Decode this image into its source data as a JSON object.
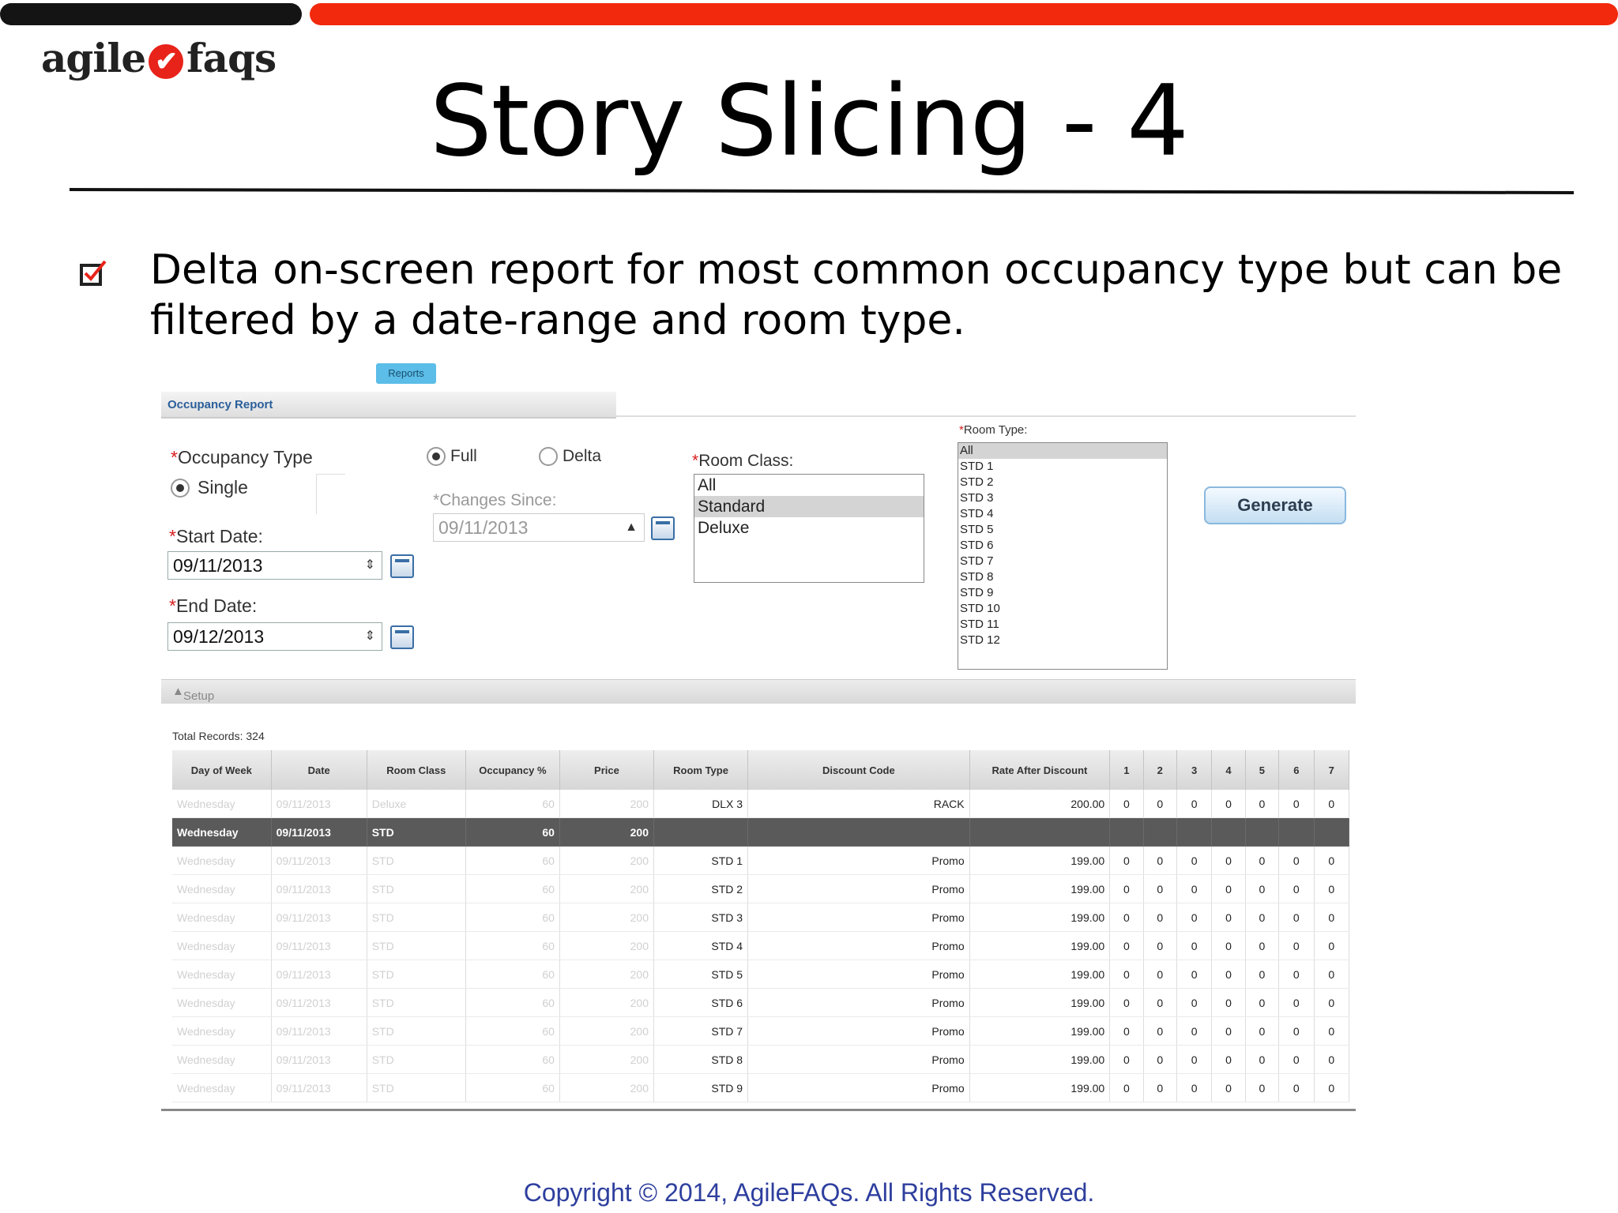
{
  "slide": {
    "logo_left": "agile",
    "logo_right": "faqs",
    "title": "Story Slicing - 4",
    "bullet": "Delta on-screen report for most common occupancy type but can be filtered by a date-range and room type.",
    "copyright": "Copyright © 2014, AgileFAQs. All Rights Reserved.",
    "accent_color": "#f2290c"
  },
  "app": {
    "reports_tab": "Reports",
    "header": "Occupancy Report",
    "occupancy_type_label": "Occupancy Type",
    "single_label": "Single",
    "full_label": "Full",
    "delta_label": "Delta",
    "changes_since_label": "Changes Since:",
    "changes_since_value": "09/11/2013",
    "start_date_label": "Start Date:",
    "start_date_value": "09/11/2013",
    "end_date_label": "End Date:",
    "end_date_value": "09/12/2013",
    "room_class_label": "Room Class:",
    "room_class_options": [
      "All",
      "Standard",
      "Deluxe"
    ],
    "room_class_selected": "Standard",
    "room_type_label": "Room Type:",
    "room_type_options": [
      "All",
      "STD 1",
      "STD 2",
      "STD 3",
      "STD 4",
      "STD 5",
      "STD 6",
      "STD 7",
      "STD 8",
      "STD 9",
      "STD 10",
      "STD 11",
      "STD 12"
    ],
    "room_type_selected": "All",
    "generate_label": "Generate",
    "setup_label": "Setup",
    "total_records": "Total Records: 324",
    "columns": [
      "Day of Week",
      "Date",
      "Room Class",
      "Occupancy %",
      "Price",
      "Room Type",
      "Discount Code",
      "Rate After Discount",
      "1",
      "2",
      "3",
      "4",
      "5",
      "6",
      "7"
    ],
    "rows": [
      {
        "day": "Wednesday",
        "date": "09/11/2013",
        "cls": "Deluxe",
        "occ": "60",
        "price": "200",
        "type": "DLX 3",
        "code": "RACK",
        "rate": "200.00",
        "d": [
          "0",
          "0",
          "0",
          "0",
          "0",
          "0",
          "0"
        ]
      },
      {
        "day": "Wednesday",
        "date": "09/11/2013",
        "cls": "STD",
        "occ": "60",
        "price": "200",
        "type": "",
        "code": "",
        "rate": "",
        "d": [
          "",
          "",
          "",
          "",
          "",
          "",
          ""
        ]
      },
      {
        "day": "Wednesday",
        "date": "09/11/2013",
        "cls": "STD",
        "occ": "60",
        "price": "200",
        "type": "STD 1",
        "code": "Promo",
        "rate": "199.00",
        "d": [
          "0",
          "0",
          "0",
          "0",
          "0",
          "0",
          "0"
        ]
      },
      {
        "day": "Wednesday",
        "date": "09/11/2013",
        "cls": "STD",
        "occ": "60",
        "price": "200",
        "type": "STD 2",
        "code": "Promo",
        "rate": "199.00",
        "d": [
          "0",
          "0",
          "0",
          "0",
          "0",
          "0",
          "0"
        ]
      },
      {
        "day": "Wednesday",
        "date": "09/11/2013",
        "cls": "STD",
        "occ": "60",
        "price": "200",
        "type": "STD 3",
        "code": "Promo",
        "rate": "199.00",
        "d": [
          "0",
          "0",
          "0",
          "0",
          "0",
          "0",
          "0"
        ]
      },
      {
        "day": "Wednesday",
        "date": "09/11/2013",
        "cls": "STD",
        "occ": "60",
        "price": "200",
        "type": "STD 4",
        "code": "Promo",
        "rate": "199.00",
        "d": [
          "0",
          "0",
          "0",
          "0",
          "0",
          "0",
          "0"
        ]
      },
      {
        "day": "Wednesday",
        "date": "09/11/2013",
        "cls": "STD",
        "occ": "60",
        "price": "200",
        "type": "STD 5",
        "code": "Promo",
        "rate": "199.00",
        "d": [
          "0",
          "0",
          "0",
          "0",
          "0",
          "0",
          "0"
        ]
      },
      {
        "day": "Wednesday",
        "date": "09/11/2013",
        "cls": "STD",
        "occ": "60",
        "price": "200",
        "type": "STD 6",
        "code": "Promo",
        "rate": "199.00",
        "d": [
          "0",
          "0",
          "0",
          "0",
          "0",
          "0",
          "0"
        ]
      },
      {
        "day": "Wednesday",
        "date": "09/11/2013",
        "cls": "STD",
        "occ": "60",
        "price": "200",
        "type": "STD 7",
        "code": "Promo",
        "rate": "199.00",
        "d": [
          "0",
          "0",
          "0",
          "0",
          "0",
          "0",
          "0"
        ]
      },
      {
        "day": "Wednesday",
        "date": "09/11/2013",
        "cls": "STD",
        "occ": "60",
        "price": "200",
        "type": "STD 8",
        "code": "Promo",
        "rate": "199.00",
        "d": [
          "0",
          "0",
          "0",
          "0",
          "0",
          "0",
          "0"
        ]
      },
      {
        "day": "Wednesday",
        "date": "09/11/2013",
        "cls": "STD",
        "occ": "60",
        "price": "200",
        "type": "STD 9",
        "code": "Promo",
        "rate": "199.00",
        "d": [
          "0",
          "0",
          "0",
          "0",
          "0",
          "0",
          "0"
        ]
      }
    ],
    "highlight_row": 1
  }
}
